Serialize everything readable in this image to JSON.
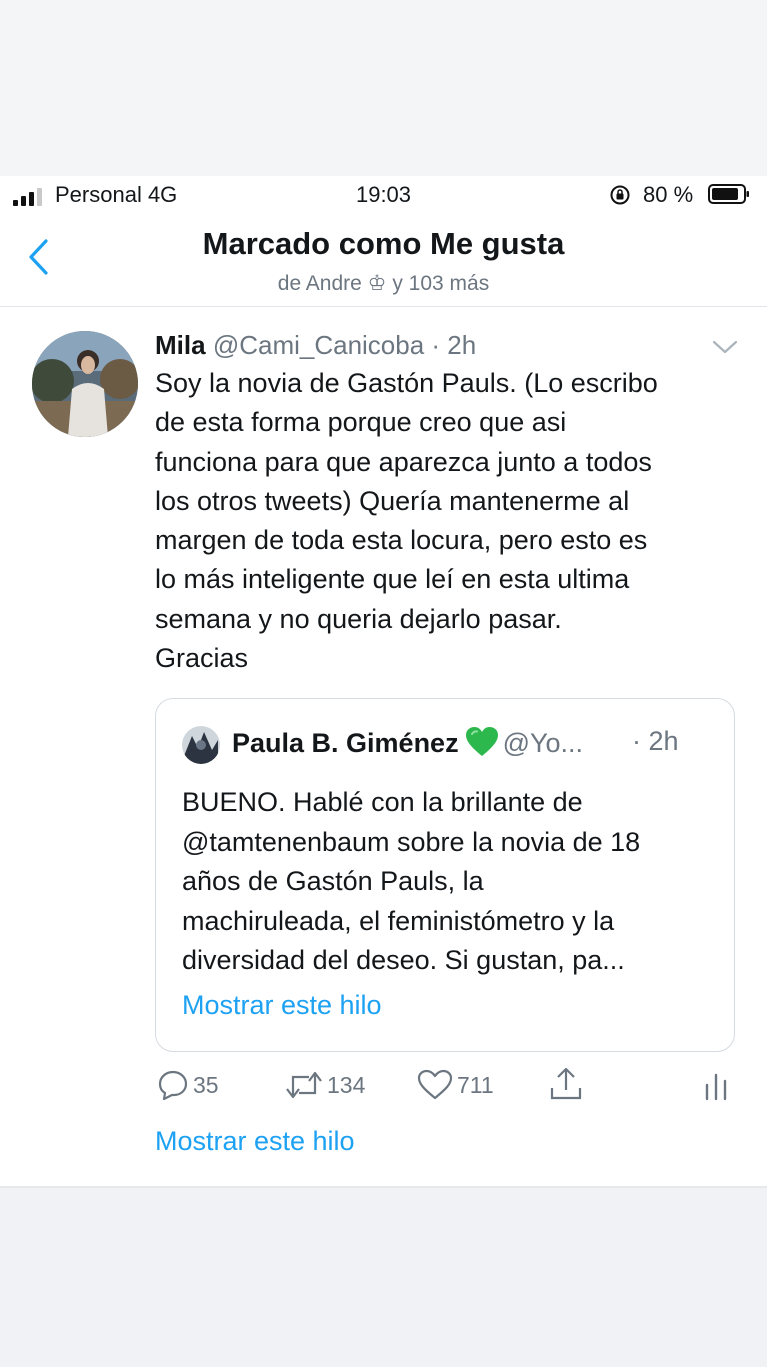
{
  "status_bar": {
    "carrier": "Personal 4G",
    "time": "19:03",
    "battery": "80 %"
  },
  "header": {
    "title": "Marcado como Me gusta",
    "subtitle": "de Andre ♔ y 103 más"
  },
  "tweet": {
    "name": "Mila",
    "handle_time": "@Cami_Canicoba · 2h",
    "text_lines": [
      "Soy la novia de Gastón Pauls. (Lo escribo",
      "de esta forma porque creo que asi",
      "funciona para que aparezca junto a todos",
      "los otros tweets) Quería mantenerme al",
      "margen de toda esta locura, pero esto es",
      "lo más inteligente que leí en esta ultima",
      "semana y no queria dejarlo pasar.",
      "Gracias"
    ],
    "quoted": {
      "name": "Paula B. Giménez",
      "handle": "@Yo...",
      "time": "· 2h",
      "text_lines": [
        "BUENO. Hablé con la brillante de",
        "@tamtenenbaum sobre la novia de 18",
        "años de Gastón Pauls, la",
        "machiruleada, el feministómetro y la",
        "diversidad del deseo. Si gustan, pa..."
      ],
      "thread_link": "Mostrar este hilo"
    },
    "actions": {
      "replies": "35",
      "retweets": "134",
      "likes": "711"
    },
    "thread_link": "Mostrar este hilo"
  },
  "colors": {
    "accent": "#1da1f2",
    "secondary_text": "#6c7680",
    "heart_green": "#2db84d"
  }
}
